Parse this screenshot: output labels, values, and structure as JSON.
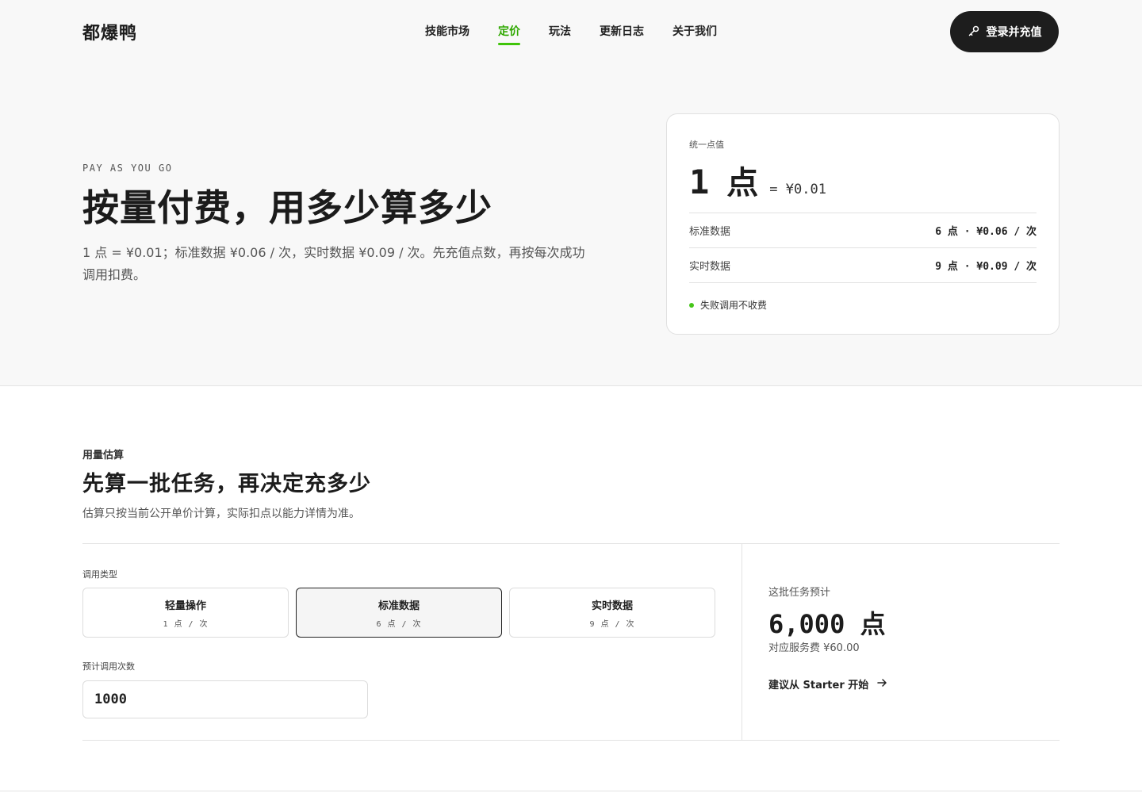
{
  "brand": {
    "name": "都爆鸭"
  },
  "nav": {
    "items": [
      {
        "label": "技能市场",
        "active": false
      },
      {
        "label": "定价",
        "active": true
      },
      {
        "label": "玩法",
        "active": false
      },
      {
        "label": "更新日志",
        "active": false
      },
      {
        "label": "关于我们",
        "active": false
      }
    ],
    "cta_label": "登录并充值",
    "cta_icon": "key-icon"
  },
  "hero": {
    "eyebrow": "PAY AS YOU GO",
    "title": "按量付费，用多少算多少",
    "description": "1 点 = ¥0.01；标准数据 ¥0.06 / 次，实时数据 ¥0.09 / 次。先充值点数，再按每次成功调用扣费。"
  },
  "points_card": {
    "label": "统一点值",
    "big_number": "1",
    "big_unit": "点",
    "equals": "= ¥0.01",
    "rows": [
      {
        "name": "标准数据",
        "value": "6 点 · ¥0.06 / 次"
      },
      {
        "name": "实时数据",
        "value": "9 点 · ¥0.09 / 次"
      }
    ],
    "note": "失败调用不收费",
    "accent": "#46c61a"
  },
  "estimate": {
    "kicker": "用量估算",
    "title": "先算一批任务，再决定充多少",
    "description": "估算只按当前公开单价计算，实际扣点以能力详情为准。",
    "type_label": "调用类型",
    "types": [
      {
        "name": "轻量操作",
        "cost": "1 点 / 次",
        "selected": false
      },
      {
        "name": "标准数据",
        "cost": "6 点 / 次",
        "selected": true
      },
      {
        "name": "实时数据",
        "cost": "9 点 / 次",
        "selected": false
      }
    ],
    "count_label": "预计调用次数",
    "count_value": "1000",
    "result_label": "这批任务预计",
    "result_total": "6,000 点",
    "result_fee": "对应服务费 ¥60.00",
    "suggest_link": "建议从 Starter 开始"
  }
}
